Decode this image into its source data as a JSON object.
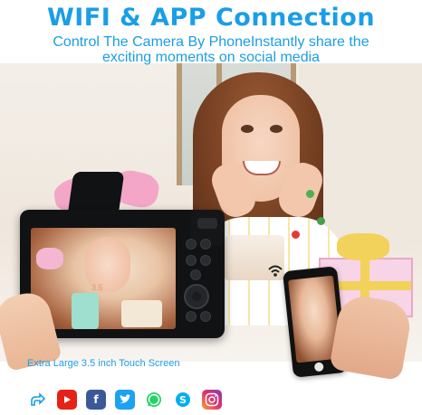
{
  "header": {
    "title": "WIFI & APP Connection",
    "subtitle_line1": "Control The Camera By PhoneInstantly share the",
    "subtitle_line2": "exciting moments on social media"
  },
  "camera": {
    "screen_size_mark": "3.5"
  },
  "caption": "Extra Large 3.5 inch Touch Screen",
  "social_icons": [
    {
      "icon": "share-icon",
      "color": "#1a9ee6"
    },
    {
      "icon": "youtube-icon",
      "color": "#e62117"
    },
    {
      "icon": "facebook-icon",
      "color": "#3b5998"
    },
    {
      "icon": "twitter-icon",
      "color": "#1da1f2"
    },
    {
      "icon": "whatsapp-icon",
      "color": "#25d366"
    },
    {
      "icon": "skype-icon",
      "color": "#00aff0"
    },
    {
      "icon": "instagram-icon",
      "color": "#e1306c"
    }
  ],
  "colors": {
    "accent": "#1a9ee6"
  }
}
